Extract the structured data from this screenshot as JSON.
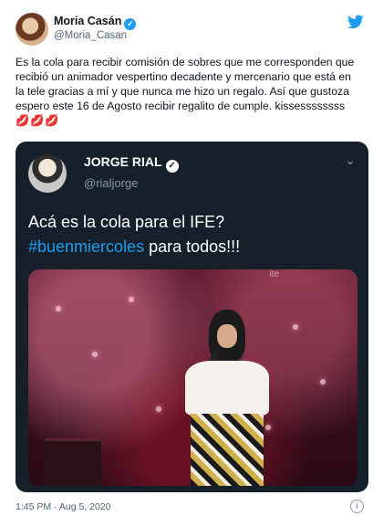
{
  "author": {
    "name": "Moria Casán",
    "handle": "@Moria_Casan",
    "verified_glyph": "✓"
  },
  "tweet": {
    "text": "Es la cola para recibir comisión de sobres que me corresponden que recibió un animador vespertino decadente y mercenario que está en la tele gracias a mí y que nunca me hizo un regalo. Así que gustoza espero este 16 de Agosto recibir regalito de cumple. kissessssssss",
    "emoji": "💋💋💋"
  },
  "quoted_tweet": {
    "name": "JORGE RIAL",
    "handle": "@rialjorge",
    "verified_glyph": "✓",
    "text_line1": "Acá es la cola para el IFE?",
    "hashtag": "#buenmiercoles",
    "text_line2_rest": " para todos!!!",
    "overlay_text": "ite"
  },
  "meta": {
    "timestamp": "1:45 PM · Aug 5, 2020"
  },
  "icons": [
    "twitter-bird-icon",
    "verified-badge-icon",
    "chevron-down-icon",
    "info-icon"
  ],
  "colors": {
    "accent": "#1d9bf0",
    "quote_bg": "#15202b",
    "text_primary": "#0f1419",
    "text_secondary": "#536471"
  }
}
